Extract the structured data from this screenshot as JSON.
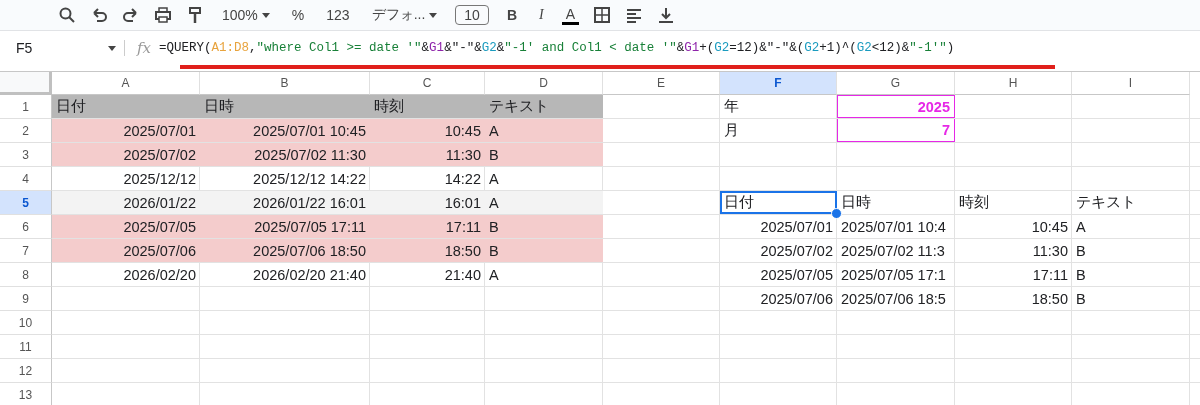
{
  "toolbar": [
    {
      "kind": "search"
    },
    {
      "kind": "undo"
    },
    {
      "kind": "redo"
    },
    {
      "kind": "print"
    },
    {
      "kind": "paint-format"
    },
    {
      "kind": "menu",
      "text": "100%",
      "dropdown": true
    },
    {
      "kind": "plain",
      "text": "%"
    },
    {
      "kind": "plain",
      "text": "123"
    },
    {
      "kind": "menu",
      "text": "デフォ...",
      "dropdown": true
    },
    {
      "kind": "font-size",
      "text": "10"
    },
    {
      "kind": "bold",
      "text": "B"
    },
    {
      "kind": "italic",
      "text": "I"
    },
    {
      "kind": "text-color",
      "text": "A"
    },
    {
      "kind": "borders"
    },
    {
      "kind": "align"
    },
    {
      "kind": "valign"
    }
  ],
  "name_box": "F5",
  "function_label": "fx",
  "formula": [
    {
      "text": "=QUERY("
    },
    {
      "text": "A1:D8",
      "color": "#e8a33d"
    },
    {
      "text": ","
    },
    {
      "text": "\"where Col1 >= date '\"",
      "color": "#188038"
    },
    {
      "text": "&"
    },
    {
      "text": "G1",
      "color": "#8e24aa"
    },
    {
      "text": "&\"-\"&"
    },
    {
      "text": "G2",
      "color": "#1a9bbf"
    },
    {
      "text": "&"
    },
    {
      "text": "\"-1' and Col1 < date '\"",
      "color": "#188038"
    },
    {
      "text": "&"
    },
    {
      "text": "G1",
      "color": "#8e24aa"
    },
    {
      "text": "+("
    },
    {
      "text": "G2",
      "color": "#1a9bbf"
    },
    {
      "text": "=12)&\"-\"&("
    },
    {
      "text": "G2",
      "color": "#1a9bbf"
    },
    {
      "text": "+1)^("
    },
    {
      "text": "G2",
      "color": "#1a9bbf"
    },
    {
      "text": "<12)&"
    },
    {
      "text": "\"-1'\"",
      "color": "#188038"
    },
    {
      "text": ")"
    }
  ],
  "columns": [
    {
      "label": "A",
      "selected": false
    },
    {
      "label": "B",
      "selected": false
    },
    {
      "label": "C",
      "selected": false
    },
    {
      "label": "D",
      "selected": false
    },
    {
      "label": "E",
      "selected": false
    },
    {
      "label": "F",
      "selected": true
    },
    {
      "label": "G",
      "selected": false
    },
    {
      "label": "H",
      "selected": false
    },
    {
      "label": "I",
      "selected": false
    }
  ],
  "rows": [
    {
      "number": "1",
      "selected": false,
      "cells": [
        {
          "text": "日付",
          "kind": "header"
        },
        {
          "text": "日時",
          "kind": "header"
        },
        {
          "text": "時刻",
          "kind": "header"
        },
        {
          "text": "テキスト",
          "kind": "header"
        },
        {},
        {
          "text": "年"
        },
        {
          "text": "2025",
          "kind": "input",
          "numeric": true
        },
        {},
        {}
      ]
    },
    {
      "number": "2",
      "selected": false,
      "cells": [
        {
          "text": "2025/07/01",
          "kind": "highlight",
          "numeric": true
        },
        {
          "text": "2025/07/01 10:45",
          "kind": "highlight",
          "numeric": true
        },
        {
          "text": "10:45",
          "kind": "highlight",
          "numeric": true
        },
        {
          "text": "A",
          "kind": "highlight"
        },
        {},
        {
          "text": "月"
        },
        {
          "text": "7",
          "kind": "input",
          "numeric": true
        },
        {},
        {}
      ]
    },
    {
      "number": "3",
      "selected": false,
      "cells": [
        {
          "text": "2025/07/02",
          "kind": "highlight",
          "numeric": true
        },
        {
          "text": "2025/07/02 11:30",
          "kind": "highlight",
          "numeric": true
        },
        {
          "text": "11:30",
          "kind": "highlight",
          "numeric": true
        },
        {
          "text": "B",
          "kind": "highlight"
        },
        {},
        {},
        {},
        {},
        {}
      ]
    },
    {
      "number": "4",
      "selected": false,
      "cells": [
        {
          "text": "2025/12/12",
          "numeric": true
        },
        {
          "text": "2025/12/12 14:22",
          "numeric": true
        },
        {
          "text": "14:22",
          "numeric": true
        },
        {
          "text": "A"
        },
        {},
        {},
        {},
        {},
        {}
      ]
    },
    {
      "number": "5",
      "selected": true,
      "cells": [
        {
          "text": "2026/01/22",
          "kind": "shaded",
          "numeric": true
        },
        {
          "text": "2026/01/22 16:01",
          "kind": "shaded",
          "numeric": true
        },
        {
          "text": "16:01",
          "kind": "shaded",
          "numeric": true
        },
        {
          "text": "A",
          "kind": "shaded"
        },
        {},
        {
          "text": "日付"
        },
        {
          "text": "日時"
        },
        {
          "text": "時刻"
        },
        {
          "text": "テキスト"
        }
      ]
    },
    {
      "number": "6",
      "selected": false,
      "cells": [
        {
          "text": "2025/07/05",
          "kind": "highlight",
          "numeric": true
        },
        {
          "text": "2025/07/05 17:11",
          "kind": "highlight",
          "numeric": true
        },
        {
          "text": "17:11",
          "kind": "highlight",
          "numeric": true
        },
        {
          "text": "B",
          "kind": "highlight"
        },
        {},
        {
          "text": "2025/07/01",
          "numeric": true
        },
        {
          "text": "2025/07/01 10:4"
        },
        {
          "text": "10:45",
          "numeric": true
        },
        {
          "text": "A"
        }
      ]
    },
    {
      "number": "7",
      "selected": false,
      "cells": [
        {
          "text": "2025/07/06",
          "kind": "highlight",
          "numeric": true
        },
        {
          "text": "2025/07/06 18:50",
          "kind": "highlight",
          "numeric": true
        },
        {
          "text": "18:50",
          "kind": "highlight",
          "numeric": true
        },
        {
          "text": "B",
          "kind": "highlight"
        },
        {},
        {
          "text": "2025/07/02",
          "numeric": true
        },
        {
          "text": "2025/07/02 11:3"
        },
        {
          "text": "11:30",
          "numeric": true
        },
        {
          "text": "B"
        }
      ]
    },
    {
      "number": "8",
      "selected": false,
      "cells": [
        {
          "text": "2026/02/20",
          "numeric": true
        },
        {
          "text": "2026/02/20 21:40",
          "numeric": true
        },
        {
          "text": "21:40",
          "numeric": true
        },
        {
          "text": "A"
        },
        {},
        {
          "text": "2025/07/05",
          "numeric": true
        },
        {
          "text": "2025/07/05 17:1"
        },
        {
          "text": "17:11",
          "numeric": true
        },
        {
          "text": "B"
        }
      ]
    },
    {
      "number": "9",
      "selected": false,
      "cells": [
        {},
        {},
        {},
        {},
        {},
        {
          "text": "2025/07/06",
          "numeric": true
        },
        {
          "text": "2025/07/06 18:5"
        },
        {
          "text": "18:50",
          "numeric": true
        },
        {
          "text": "B"
        }
      ]
    },
    {
      "number": "10",
      "selected": false,
      "cells": [
        {},
        {},
        {},
        {},
        {},
        {},
        {},
        {},
        {}
      ]
    },
    {
      "number": "11",
      "selected": false,
      "cells": [
        {},
        {},
        {},
        {},
        {},
        {},
        {},
        {},
        {}
      ]
    },
    {
      "number": "12",
      "selected": false,
      "cells": [
        {},
        {},
        {},
        {},
        {},
        {},
        {},
        {},
        {}
      ]
    },
    {
      "number": "13",
      "selected": false,
      "cells": [
        {},
        {},
        {},
        {},
        {},
        {},
        {},
        {},
        {}
      ]
    }
  ]
}
